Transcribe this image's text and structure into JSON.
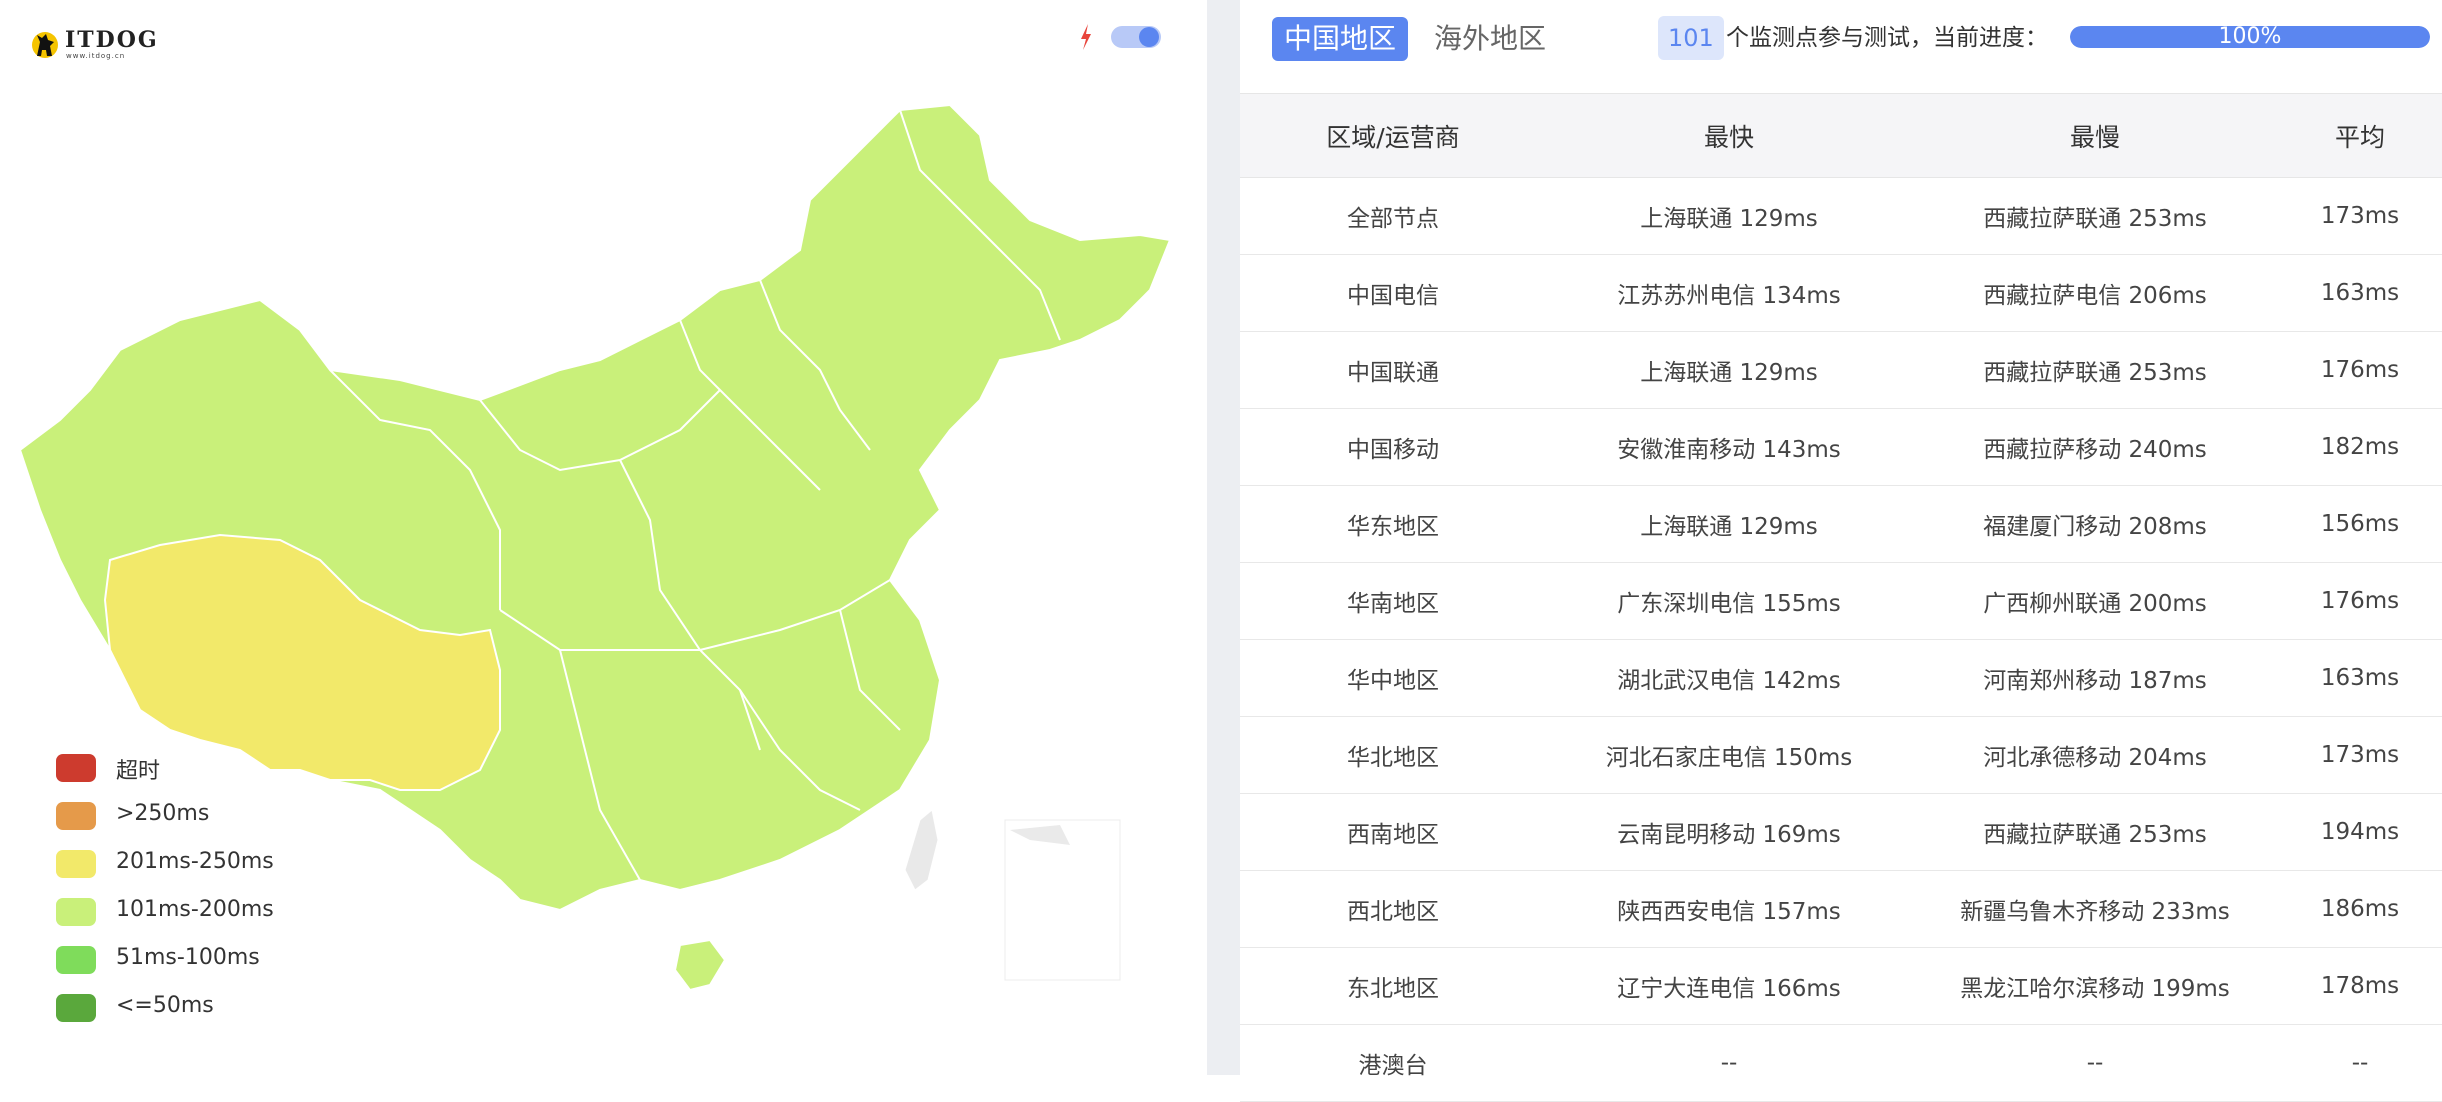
{
  "logo": {
    "text": "ITDOG",
    "subtext": "www.itdog.cn"
  },
  "toggle": {
    "state": "on"
  },
  "legend": [
    {
      "label": "超时",
      "color": "#cd3b2e"
    },
    {
      "label": ">250ms",
      "color": "#e59a4a"
    },
    {
      "label": "201ms-250ms",
      "color": "#f2e96a"
    },
    {
      "label": "101ms-200ms",
      "color": "#c9f07a"
    },
    {
      "label": "51ms-100ms",
      "color": "#7fdc5b"
    },
    {
      "label": "<=50ms",
      "color": "#5aa83c"
    }
  ],
  "map": {
    "colors": {
      "fast": "#c9f07a",
      "tibet": "#f2e96a",
      "border": "#ffffff",
      "taiwan": "#e9e9e9"
    }
  },
  "tabs": {
    "china": "中国地区",
    "overseas": "海外地区"
  },
  "progress": {
    "count": "101",
    "text": "个监测点参与测试，当前进度：",
    "percent": 100,
    "label": "100%"
  },
  "table": {
    "headers": [
      "区域/运营商",
      "最快",
      "最慢",
      "平均"
    ],
    "rows": [
      [
        "全部节点",
        "上海联通 129ms",
        "西藏拉萨联通 253ms",
        "173ms"
      ],
      [
        "中国电信",
        "江苏苏州电信 134ms",
        "西藏拉萨电信 206ms",
        "163ms"
      ],
      [
        "中国联通",
        "上海联通 129ms",
        "西藏拉萨联通 253ms",
        "176ms"
      ],
      [
        "中国移动",
        "安徽淮南移动 143ms",
        "西藏拉萨移动 240ms",
        "182ms"
      ],
      [
        "华东地区",
        "上海联通 129ms",
        "福建厦门移动 208ms",
        "156ms"
      ],
      [
        "华南地区",
        "广东深圳电信 155ms",
        "广西柳州联通 200ms",
        "176ms"
      ],
      [
        "华中地区",
        "湖北武汉电信 142ms",
        "河南郑州移动 187ms",
        "163ms"
      ],
      [
        "华北地区",
        "河北石家庄电信 150ms",
        "河北承德移动 204ms",
        "173ms"
      ],
      [
        "西南地区",
        "云南昆明移动 169ms",
        "西藏拉萨联通 253ms",
        "194ms"
      ],
      [
        "西北地区",
        "陕西西安电信 157ms",
        "新疆乌鲁木齐移动 233ms",
        "186ms"
      ],
      [
        "东北地区",
        "辽宁大连电信 166ms",
        "黑龙江哈尔滨移动 199ms",
        "178ms"
      ],
      [
        "港澳台",
        "--",
        "--",
        "--"
      ]
    ]
  }
}
